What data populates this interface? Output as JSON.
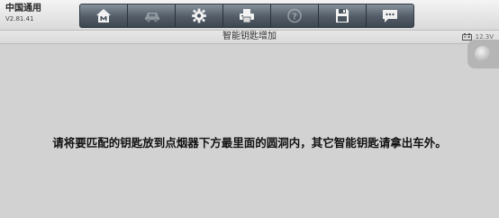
{
  "header": {
    "brand_title": "中国通用",
    "version": "V2.81.41"
  },
  "toolbar": {
    "buttons": [
      {
        "icon": "home-icon",
        "state": "enabled"
      },
      {
        "icon": "car-icon",
        "state": "disabled"
      },
      {
        "icon": "gear-icon",
        "state": "enabled"
      },
      {
        "icon": "printer-icon",
        "state": "enabled"
      },
      {
        "icon": "help-icon",
        "state": "disabled"
      },
      {
        "icon": "save-icon",
        "state": "enabled"
      },
      {
        "icon": "message-icon",
        "state": "enabled"
      }
    ]
  },
  "subheader": {
    "title": "智能钥匙增加",
    "battery_voltage": "12.3V"
  },
  "main": {
    "message": "请将要匹配的钥匙放到点烟器下方最里面的圆洞内，其它智能钥匙请拿出车外。"
  },
  "colors": {
    "background": "#d2d2d2",
    "toolbar_button": "#525c67",
    "text": "#111111"
  }
}
